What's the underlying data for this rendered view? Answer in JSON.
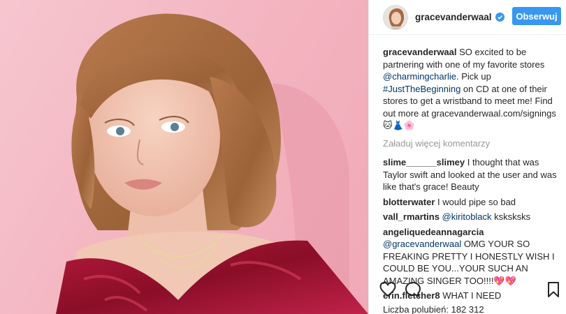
{
  "header": {
    "username": "gracevanderwaal",
    "follow_label": "Obserwuj"
  },
  "caption": {
    "username": "gracevanderwaal",
    "part1": " SO excited to be partnering with one of my favorite stores ",
    "mention": "@charmingcharlie",
    "part2": ". Pick up ",
    "hashtag": "#JustTheBeginning",
    "part3": " on CD at one of their stores to get a wristband to meet me! Find out more at gracevanderwaal.com/signings ",
    "emoji": "🐱👗🌸"
  },
  "load_more": "Załaduj więcej komentarzy",
  "comments": [
    {
      "username": "slime______slimey",
      "mention": "",
      "text": " I thought that was Taylor swift and looked at the user and was like that's grace! Beauty"
    },
    {
      "username": "blotterwater",
      "mention": "",
      "text": " I would pipe so bad"
    },
    {
      "username": "vall_rmartins",
      "mention": " @kiritoblack",
      "text": " ksksksks"
    },
    {
      "username": "angeliquedeannagarcia",
      "mention": " @gracevanderwaal",
      "text": " OMG YOUR SO FREAKING PRETTY I HONESTLY WISH I COULD BE YOU...YOUR SUCH AN AMAZING SINGER TOO!!!!💖💖"
    },
    {
      "username": "erin.fletcher8",
      "mention": "",
      "text": " WHAT I NEED"
    }
  ],
  "likes": {
    "label": "Liczba polubień:",
    "count": "182 312"
  },
  "icons": {
    "like": "heart-icon",
    "comment": "comment-bubble-icon",
    "save": "bookmark-icon",
    "verified": "verified-badge-icon"
  },
  "colors": {
    "accent": "#3897f0",
    "link": "#003569",
    "photo_background": "#f3b3bf",
    "dress": "#9e1230"
  }
}
